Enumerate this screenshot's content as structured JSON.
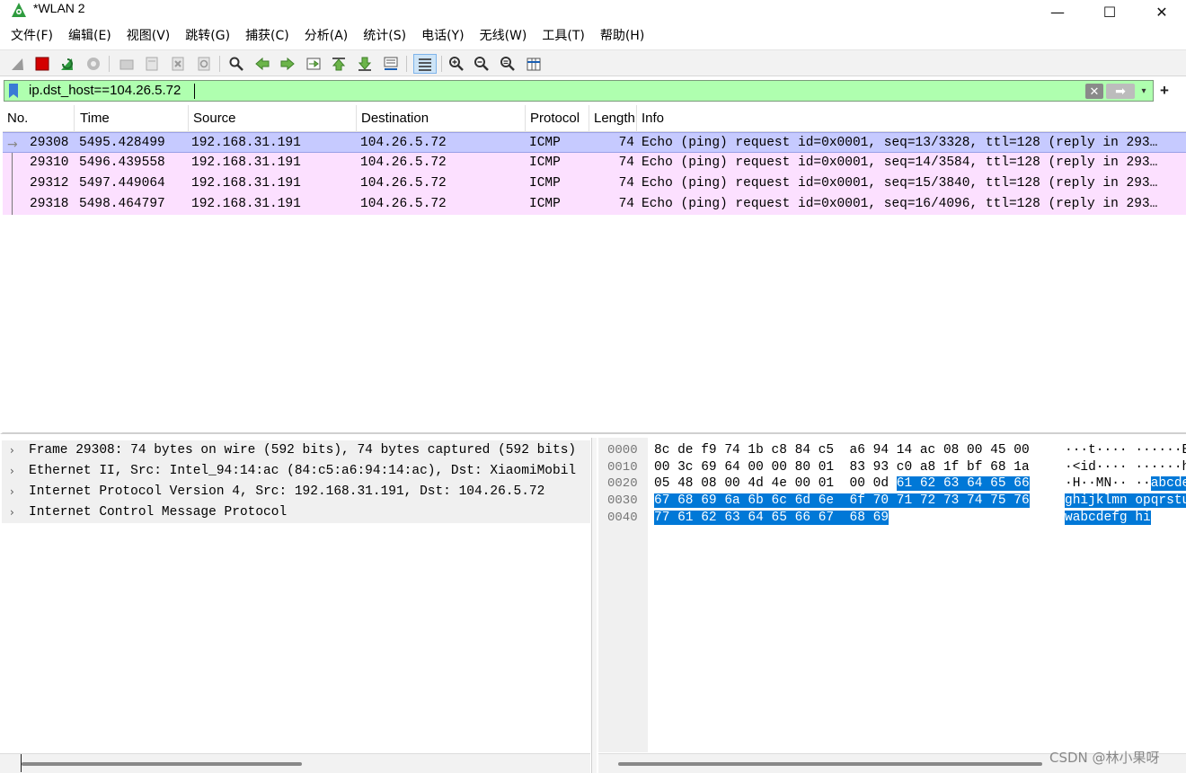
{
  "window": {
    "title": "*WLAN 2",
    "controls": [
      "—",
      "☐",
      "✕"
    ]
  },
  "menu": [
    "文件(F)",
    "编辑(E)",
    "视图(V)",
    "跳转(G)",
    "捕获(C)",
    "分析(A)",
    "统计(S)",
    "电话(Y)",
    "无线(W)",
    "工具(T)",
    "帮助(H)"
  ],
  "toolbar": {
    "icons": [
      "shark-fin-start-icon",
      "stop-capture-icon",
      "restart-capture-icon",
      "capture-options-icon",
      "open-file-icon",
      "save-file-icon",
      "close-file-icon",
      "reload-file-icon",
      "find-packet-icon",
      "go-back-icon",
      "go-forward-icon",
      "go-to-packet-icon",
      "first-packet-icon",
      "last-packet-icon",
      "autoscroll-icon",
      "colorize-icon",
      "zoom-in-icon",
      "zoom-out-icon",
      "normal-size-icon",
      "resize-columns-icon"
    ]
  },
  "filter": {
    "value": "ip.dst_host==104.26.5.72",
    "clear_glyph": "✕",
    "apply_glyph": "➡",
    "dropdown_glyph": "▾",
    "add_glyph": "+"
  },
  "packet_list": {
    "columns": [
      "No.",
      "Time",
      "Source",
      "Destination",
      "Protocol",
      "Length",
      "Info"
    ],
    "rows": [
      {
        "no": "29308",
        "time": "5495.428499",
        "source": "192.168.31.191",
        "destination": "104.26.5.72",
        "protocol": "ICMP",
        "length": "74",
        "info": "Echo (ping) request  id=0x0001, seq=13/3328, ttl=128 (reply in 293…"
      },
      {
        "no": "29310",
        "time": "5496.439558",
        "source": "192.168.31.191",
        "destination": "104.26.5.72",
        "protocol": "ICMP",
        "length": "74",
        "info": "Echo (ping) request  id=0x0001, seq=14/3584, ttl=128 (reply in 293…"
      },
      {
        "no": "29312",
        "time": "5497.449064",
        "source": "192.168.31.191",
        "destination": "104.26.5.72",
        "protocol": "ICMP",
        "length": "74",
        "info": "Echo (ping) request  id=0x0001, seq=15/3840, ttl=128 (reply in 293…"
      },
      {
        "no": "29318",
        "time": "5498.464797",
        "source": "192.168.31.191",
        "destination": "104.26.5.72",
        "protocol": "ICMP",
        "length": "74",
        "info": "Echo (ping) request  id=0x0001, seq=16/4096, ttl=128 (reply in 293…"
      }
    ]
  },
  "details": {
    "arrow": "›",
    "items": [
      "Frame 29308: 74 bytes on wire (592 bits), 74 bytes captured (592 bits)",
      "Ethernet II, Src: Intel_94:14:ac (84:c5:a6:94:14:ac), Dst: XiaomiMobil",
      "Internet Protocol Version 4, Src: 192.168.31.191, Dst: 104.26.5.72",
      "Internet Control Message Protocol"
    ]
  },
  "bytes": {
    "offsets": [
      "0000",
      "0010",
      "0020",
      "0030",
      "0040"
    ],
    "lines": [
      {
        "hex_plain": "8c de f9 74 1b c8 84 c5  a6 94 14 ac 08 00 45 00",
        "hex_hl": "",
        "ascii_plain": "···t···· ······E·",
        "ascii_hl": ""
      },
      {
        "hex_plain": "00 3c 69 64 00 00 80 01  83 93 c0 a8 1f bf 68 1a",
        "hex_hl": "",
        "ascii_plain": "·<id···· ······h·",
        "ascii_hl": ""
      },
      {
        "hex_plain": "05 48 08 00 4d 4e 00 01  00 0d ",
        "hex_hl": "61 62 63 64 65 66",
        "ascii_plain": "·H··MN·· ··",
        "ascii_hl": "abcdef"
      },
      {
        "hex_plain": "",
        "hex_hl": "67 68 69 6a 6b 6c 6d 6e  6f 70 71 72 73 74 75 76",
        "ascii_plain": "",
        "ascii_hl": "ghijklmn opqrstuv"
      },
      {
        "hex_plain": "",
        "hex_hl": "77 61 62 63 64 65 66 67  68 69",
        "ascii_plain": "",
        "ascii_hl": "wabcdefg hi"
      }
    ]
  },
  "watermark": "CSDN @林小果呀",
  "colors": {
    "filter_valid_bg": "#afffaf",
    "row_icmp_bg": "#fce0ff",
    "row_selected_bg": "#c6caff",
    "byte_highlight_bg": "#0078d7"
  }
}
